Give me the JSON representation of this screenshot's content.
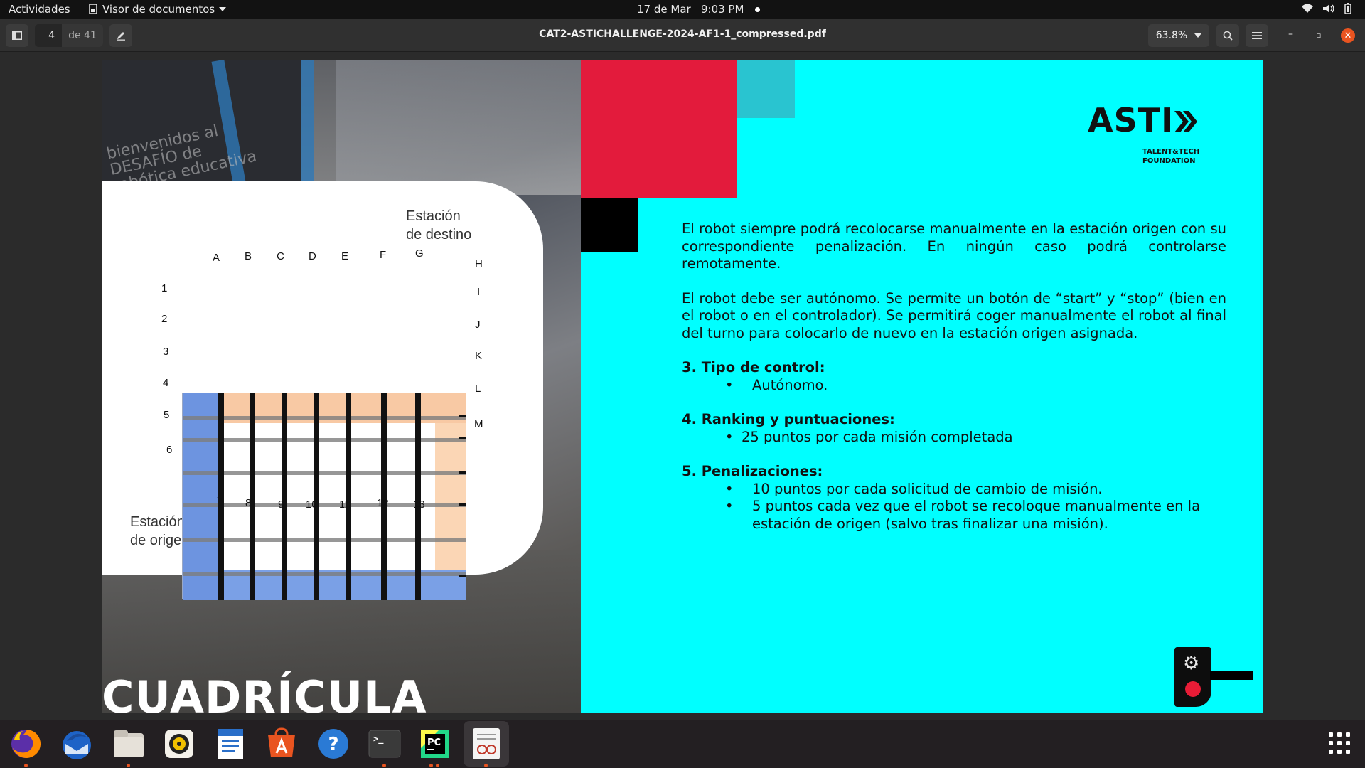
{
  "topbar": {
    "activities": "Actividades",
    "app_name": "Visor de documentos",
    "clock": "17 de Mar   9:03 PM",
    "tray": [
      "wifi-icon",
      "volume-icon",
      "battery-icon"
    ]
  },
  "viewer": {
    "current_page": "4",
    "total_pages": "de 41",
    "title": "CAT2-ASTICHALLENGE-2024-AF1-1_compressed.pdf",
    "zoom": "63.8%",
    "window_controls": {
      "minimize": "–",
      "restore": "▫",
      "close": "✕"
    }
  },
  "page": {
    "left_title": "CUADRÍCULA",
    "banner_text": "bienvenidos al\nDESAFÍO de\nrobótica educativa",
    "station_destination": [
      "Estación",
      "de destino"
    ],
    "station_origin": [
      "Estación",
      "de origen"
    ],
    "grid": {
      "top_labels": [
        "A",
        "B",
        "C",
        "D",
        "E",
        "F",
        "G",
        "H"
      ],
      "left_labels": [
        "1",
        "2",
        "3",
        "4",
        "5",
        "6"
      ],
      "right_labels": [
        "I",
        "J",
        "K",
        "L",
        "M"
      ],
      "bottom_labels": [
        "7",
        "8",
        "9",
        "10",
        "11",
        "12",
        "13"
      ]
    },
    "logo": {
      "word": "ASTI",
      "sub1": "TALENT&TECH",
      "sub2": "FOUNDATION"
    },
    "paragraph1": "El robot siempre podrá recolocarse manualmente en la estación origen con su correspondiente penalización. En ningún caso podrá controlarse remotamente.",
    "paragraph2": "El robot debe ser autónomo. Se permite un botón de “start” y “stop” (bien en el robot o en el controlador). Se permitirá coger manualmente el robot al final del turno para colocarlo de nuevo en la estación origen asignada.",
    "section3": {
      "title": "3. Tipo de control:",
      "items": [
        "Autónomo."
      ]
    },
    "section4": {
      "title": "4. Ranking y puntuaciones:",
      "items": [
        "25 puntos por cada misión completada"
      ]
    },
    "section5": {
      "title": "5. Penalizaciones:",
      "items": [
        "10 puntos por cada solicitud de cambio de misión.",
        "5 puntos cada vez que el robot se recoloque manualmente en la estación de origen (salvo tras finalizar una misión)."
      ]
    }
  },
  "dock": {
    "apps": [
      "firefox-icon",
      "thunderbird-icon",
      "files-icon",
      "rhythmbox-icon",
      "writer-icon",
      "software-icon",
      "help-icon",
      "terminal-icon",
      "pycharm-icon",
      "document-viewer-icon"
    ],
    "terminal_glyph": ">_",
    "pycharm_glyph": "PC",
    "help_glyph": "?"
  },
  "colors": {
    "accent": "#e95420",
    "page_cyan": "#00ffff",
    "red_block": "#e31b3c",
    "teal_block": "#29c4d0"
  }
}
